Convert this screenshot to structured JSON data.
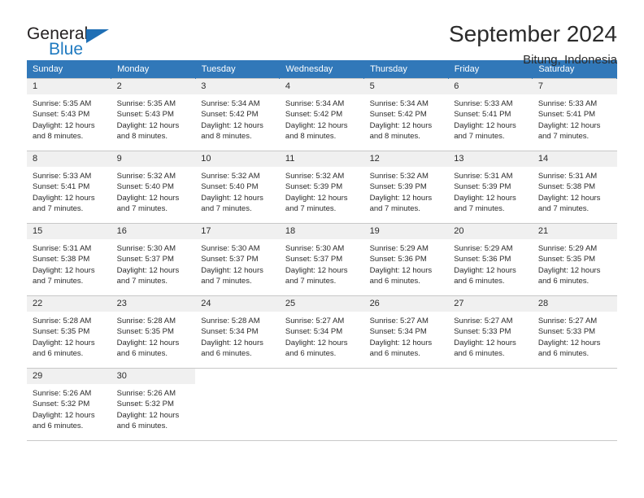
{
  "brand": {
    "line1": "General",
    "line2": "Blue",
    "triangle_color": "#1f6fb5"
  },
  "header": {
    "title": "September 2024",
    "location": "Bitung, Indonesia",
    "header_bg": "#3178b9",
    "daynum_bg": "#f0f0f0"
  },
  "weekdays": [
    "Sunday",
    "Monday",
    "Tuesday",
    "Wednesday",
    "Thursday",
    "Friday",
    "Saturday"
  ],
  "labels": {
    "sunrise_prefix": "Sunrise: ",
    "sunset_prefix": "Sunset: ",
    "daylight_prefix": "Daylight: "
  },
  "weeks": [
    [
      {
        "day": "1",
        "sunrise": "Sunrise: 5:35 AM",
        "sunset": "Sunset: 5:43 PM",
        "daylight": "Daylight: 12 hours and 8 minutes."
      },
      {
        "day": "2",
        "sunrise": "Sunrise: 5:35 AM",
        "sunset": "Sunset: 5:43 PM",
        "daylight": "Daylight: 12 hours and 8 minutes."
      },
      {
        "day": "3",
        "sunrise": "Sunrise: 5:34 AM",
        "sunset": "Sunset: 5:42 PM",
        "daylight": "Daylight: 12 hours and 8 minutes."
      },
      {
        "day": "4",
        "sunrise": "Sunrise: 5:34 AM",
        "sunset": "Sunset: 5:42 PM",
        "daylight": "Daylight: 12 hours and 8 minutes."
      },
      {
        "day": "5",
        "sunrise": "Sunrise: 5:34 AM",
        "sunset": "Sunset: 5:42 PM",
        "daylight": "Daylight: 12 hours and 8 minutes."
      },
      {
        "day": "6",
        "sunrise": "Sunrise: 5:33 AM",
        "sunset": "Sunset: 5:41 PM",
        "daylight": "Daylight: 12 hours and 7 minutes."
      },
      {
        "day": "7",
        "sunrise": "Sunrise: 5:33 AM",
        "sunset": "Sunset: 5:41 PM",
        "daylight": "Daylight: 12 hours and 7 minutes."
      }
    ],
    [
      {
        "day": "8",
        "sunrise": "Sunrise: 5:33 AM",
        "sunset": "Sunset: 5:41 PM",
        "daylight": "Daylight: 12 hours and 7 minutes."
      },
      {
        "day": "9",
        "sunrise": "Sunrise: 5:32 AM",
        "sunset": "Sunset: 5:40 PM",
        "daylight": "Daylight: 12 hours and 7 minutes."
      },
      {
        "day": "10",
        "sunrise": "Sunrise: 5:32 AM",
        "sunset": "Sunset: 5:40 PM",
        "daylight": "Daylight: 12 hours and 7 minutes."
      },
      {
        "day": "11",
        "sunrise": "Sunrise: 5:32 AM",
        "sunset": "Sunset: 5:39 PM",
        "daylight": "Daylight: 12 hours and 7 minutes."
      },
      {
        "day": "12",
        "sunrise": "Sunrise: 5:32 AM",
        "sunset": "Sunset: 5:39 PM",
        "daylight": "Daylight: 12 hours and 7 minutes."
      },
      {
        "day": "13",
        "sunrise": "Sunrise: 5:31 AM",
        "sunset": "Sunset: 5:39 PM",
        "daylight": "Daylight: 12 hours and 7 minutes."
      },
      {
        "day": "14",
        "sunrise": "Sunrise: 5:31 AM",
        "sunset": "Sunset: 5:38 PM",
        "daylight": "Daylight: 12 hours and 7 minutes."
      }
    ],
    [
      {
        "day": "15",
        "sunrise": "Sunrise: 5:31 AM",
        "sunset": "Sunset: 5:38 PM",
        "daylight": "Daylight: 12 hours and 7 minutes."
      },
      {
        "day": "16",
        "sunrise": "Sunrise: 5:30 AM",
        "sunset": "Sunset: 5:37 PM",
        "daylight": "Daylight: 12 hours and 7 minutes."
      },
      {
        "day": "17",
        "sunrise": "Sunrise: 5:30 AM",
        "sunset": "Sunset: 5:37 PM",
        "daylight": "Daylight: 12 hours and 7 minutes."
      },
      {
        "day": "18",
        "sunrise": "Sunrise: 5:30 AM",
        "sunset": "Sunset: 5:37 PM",
        "daylight": "Daylight: 12 hours and 7 minutes."
      },
      {
        "day": "19",
        "sunrise": "Sunrise: 5:29 AM",
        "sunset": "Sunset: 5:36 PM",
        "daylight": "Daylight: 12 hours and 6 minutes."
      },
      {
        "day": "20",
        "sunrise": "Sunrise: 5:29 AM",
        "sunset": "Sunset: 5:36 PM",
        "daylight": "Daylight: 12 hours and 6 minutes."
      },
      {
        "day": "21",
        "sunrise": "Sunrise: 5:29 AM",
        "sunset": "Sunset: 5:35 PM",
        "daylight": "Daylight: 12 hours and 6 minutes."
      }
    ],
    [
      {
        "day": "22",
        "sunrise": "Sunrise: 5:28 AM",
        "sunset": "Sunset: 5:35 PM",
        "daylight": "Daylight: 12 hours and 6 minutes."
      },
      {
        "day": "23",
        "sunrise": "Sunrise: 5:28 AM",
        "sunset": "Sunset: 5:35 PM",
        "daylight": "Daylight: 12 hours and 6 minutes."
      },
      {
        "day": "24",
        "sunrise": "Sunrise: 5:28 AM",
        "sunset": "Sunset: 5:34 PM",
        "daylight": "Daylight: 12 hours and 6 minutes."
      },
      {
        "day": "25",
        "sunrise": "Sunrise: 5:27 AM",
        "sunset": "Sunset: 5:34 PM",
        "daylight": "Daylight: 12 hours and 6 minutes."
      },
      {
        "day": "26",
        "sunrise": "Sunrise: 5:27 AM",
        "sunset": "Sunset: 5:34 PM",
        "daylight": "Daylight: 12 hours and 6 minutes."
      },
      {
        "day": "27",
        "sunrise": "Sunrise: 5:27 AM",
        "sunset": "Sunset: 5:33 PM",
        "daylight": "Daylight: 12 hours and 6 minutes."
      },
      {
        "day": "28",
        "sunrise": "Sunrise: 5:27 AM",
        "sunset": "Sunset: 5:33 PM",
        "daylight": "Daylight: 12 hours and 6 minutes."
      }
    ],
    [
      {
        "day": "29",
        "sunrise": "Sunrise: 5:26 AM",
        "sunset": "Sunset: 5:32 PM",
        "daylight": "Daylight: 12 hours and 6 minutes."
      },
      {
        "day": "30",
        "sunrise": "Sunrise: 5:26 AM",
        "sunset": "Sunset: 5:32 PM",
        "daylight": "Daylight: 12 hours and 6 minutes."
      },
      {
        "day": "",
        "sunrise": "",
        "sunset": "",
        "daylight": ""
      },
      {
        "day": "",
        "sunrise": "",
        "sunset": "",
        "daylight": ""
      },
      {
        "day": "",
        "sunrise": "",
        "sunset": "",
        "daylight": ""
      },
      {
        "day": "",
        "sunrise": "",
        "sunset": "",
        "daylight": ""
      },
      {
        "day": "",
        "sunrise": "",
        "sunset": "",
        "daylight": ""
      }
    ]
  ]
}
